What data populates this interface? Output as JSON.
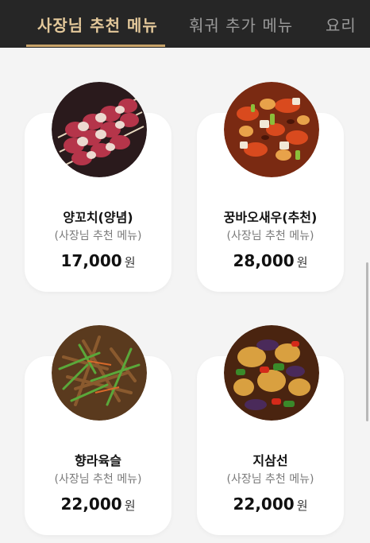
{
  "tabs": [
    {
      "label": "사장님 추천 메뉴",
      "active": true
    },
    {
      "label": "훠궈 추가 메뉴",
      "active": false
    },
    {
      "label": "요리",
      "active": false
    }
  ],
  "menu": [
    {
      "name": "양꼬치(양념)",
      "subtitle": "(사장님 추천 메뉴)",
      "price": "17,000",
      "unit": "원"
    },
    {
      "name": "꿍바오새우(추천)",
      "subtitle": "(사장님 추천 메뉴)",
      "price": "28,000",
      "unit": "원"
    },
    {
      "name": "향라육슬",
      "subtitle": "(사장님 추천 메뉴)",
      "price": "22,000",
      "unit": "원"
    },
    {
      "name": "지삼선",
      "subtitle": "(사장님 추천 메뉴)",
      "price": "22,000",
      "unit": "원"
    }
  ],
  "colors": {
    "header_bg": "#262626",
    "active_tab": "#e3c89a",
    "underline": "#c9a46a",
    "card_bg": "#ffffff",
    "page_bg": "#f4f4f4"
  }
}
